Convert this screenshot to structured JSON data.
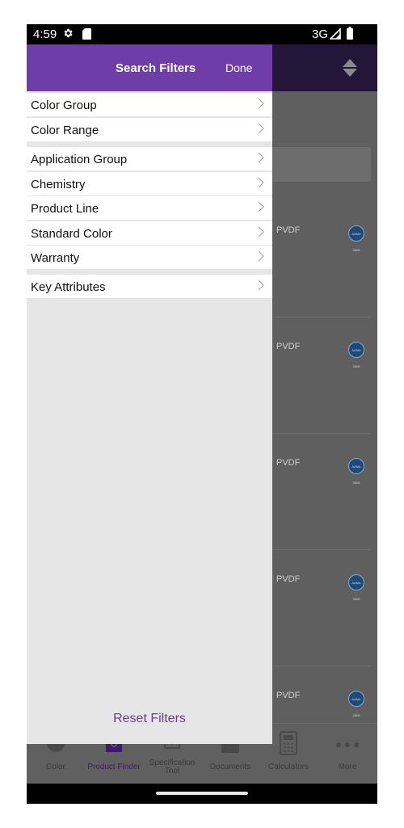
{
  "status_bar": {
    "time": "4:59",
    "network": "3G",
    "icons": [
      "gear-icon",
      "sd-card-icon",
      "signal-icon",
      "battery-icon"
    ]
  },
  "drawer": {
    "title": "Search Filters",
    "done_label": "Done",
    "reset_label": "Reset Filters",
    "groups": [
      {
        "items": [
          {
            "label": "Color Group"
          },
          {
            "label": "Color Range"
          }
        ]
      },
      {
        "items": [
          {
            "label": "Application Group"
          },
          {
            "label": "Chemistry"
          },
          {
            "label": "Product Line"
          },
          {
            "label": "Standard Color"
          },
          {
            "label": "Warranty"
          }
        ]
      },
      {
        "items": [
          {
            "label": "Key Attributes"
          }
        ]
      }
    ]
  },
  "background_list": {
    "rows": [
      {
        "label": "PVDF",
        "badge": "AAMA 2605"
      },
      {
        "label": "PVDF",
        "badge": "AAMA 2605"
      },
      {
        "label": "PVDF",
        "badge": "AAMA 2605"
      },
      {
        "label": "PVDF",
        "badge": "AAMA 2605"
      },
      {
        "label": "PVDF",
        "badge": "AAMA 2605"
      }
    ]
  },
  "tab_bar": {
    "active": "Product Finder",
    "tabs": [
      {
        "label": "Color",
        "icon": "palette-icon"
      },
      {
        "label": "Product Finder",
        "icon": "product-finder-icon"
      },
      {
        "label": "Specification Tool",
        "icon": "specification-tool-icon"
      },
      {
        "label": "Documents",
        "icon": "documents-icon"
      },
      {
        "label": "Calculators",
        "icon": "calculator-icon"
      },
      {
        "label": "More",
        "icon": "more-icon"
      }
    ]
  },
  "colors": {
    "drawer_header": "#6f3da7",
    "accent_text": "#6a3aa0",
    "app_header": "#241638"
  }
}
